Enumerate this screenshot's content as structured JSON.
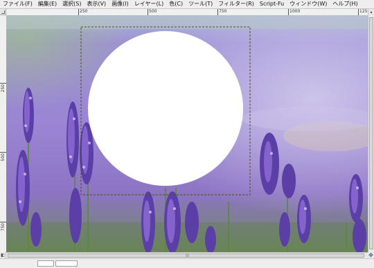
{
  "menubar": {
    "items": [
      {
        "label": "ファイル(F)"
      },
      {
        "label": "編集(E)"
      },
      {
        "label": "選択(S)"
      },
      {
        "label": "表示(V)"
      },
      {
        "label": "画像(I)"
      },
      {
        "label": "レイヤー(L)"
      },
      {
        "label": "色(C)"
      },
      {
        "label": "ツール(T)"
      },
      {
        "label": "フィルター(R)"
      },
      {
        "label": "Script-Fu"
      },
      {
        "label": "ウィンドウ(W)"
      },
      {
        "label": "ヘルプ(H)"
      }
    ]
  },
  "ruler_horizontal": {
    "labels": [
      "250",
      "500",
      "750",
      "1000",
      "1250"
    ]
  },
  "ruler_vertical": {
    "labels": [
      "250",
      "500",
      "750"
    ]
  },
  "canvas": {
    "image_description_colors": {
      "sky": "#cfd8e6",
      "lavender": "#8d76c8",
      "foliage": "#6f9a4e",
      "selection_fill": "#ffffff",
      "selection_outline": "#5a5a1e"
    }
  },
  "icons": {
    "navigate": "navigate-icon",
    "ruler_corner": "ruler-corner-icon"
  }
}
